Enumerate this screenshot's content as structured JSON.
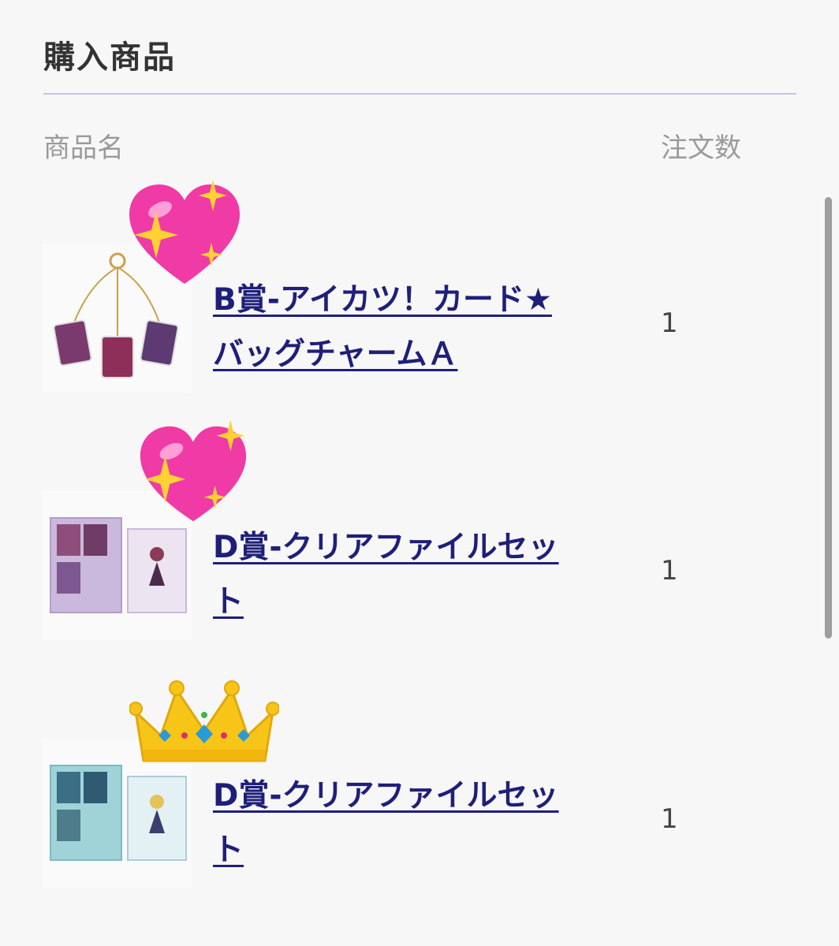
{
  "section": {
    "title": "購入商品"
  },
  "table": {
    "header_name": "商品名",
    "header_qty": "注文数"
  },
  "items": [
    {
      "name": "B賞-アイカツ！カード★バッグチャームＡ",
      "qty": "1",
      "sticker": "sparkling-heart-emoji"
    },
    {
      "name": "D賞-クリアファイルセット",
      "qty": "1",
      "sticker": "sparkling-heart-emoji"
    },
    {
      "name": "D賞-クリアファイルセット",
      "qty": "1",
      "sticker": "crown-emoji"
    }
  ],
  "colors": {
    "link": "#1f1f7a",
    "divider": "#c9c4df",
    "background": "#f7f7f7"
  }
}
